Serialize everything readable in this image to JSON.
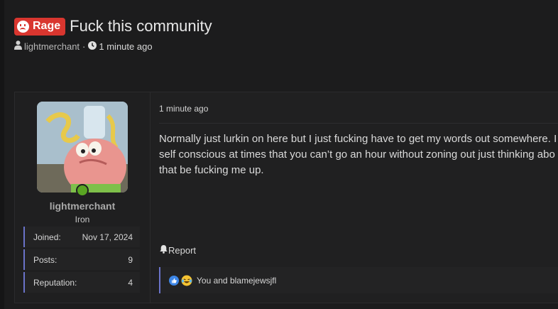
{
  "thread": {
    "prefix": "Rage",
    "title": "Fuck this community",
    "author": "lightmerchant",
    "separator": "·",
    "time": "1 minute ago"
  },
  "user": {
    "name": "lightmerchant",
    "title": "Iron",
    "stats": [
      {
        "label": "Joined:",
        "value": "Nov 17, 2024"
      },
      {
        "label": "Posts:",
        "value": "9"
      },
      {
        "label": "Reputation:",
        "value": "4"
      }
    ]
  },
  "post": {
    "time": "1 minute ago",
    "body_lines": [
      "Normally just lurkin on here but I just fucking have to get my words out somewhere. I",
      "self conscious at times that you can’t go an hour without zoning out just thinking abo",
      "that be fucking me up."
    ],
    "report_label": "Report",
    "reactions_text": "You and blamejewsjfl"
  },
  "colors": {
    "prefix_badge": "#d9362f",
    "online_dot": "#5aa623",
    "accent_border": "#6a73c9"
  }
}
